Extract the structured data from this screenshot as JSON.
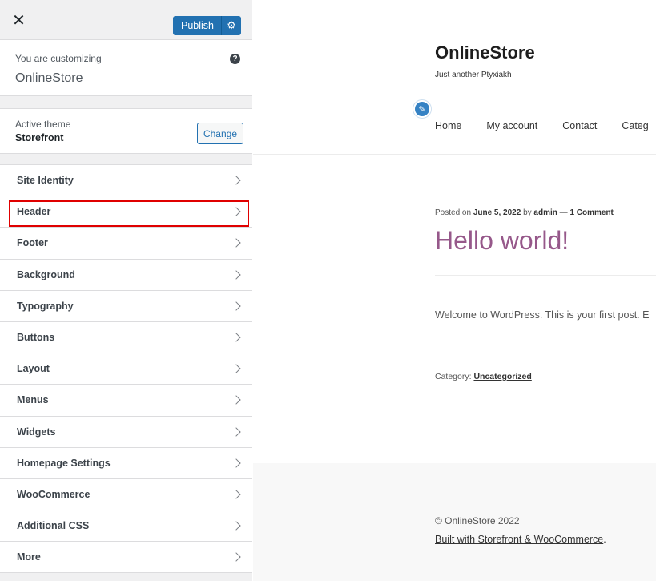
{
  "topbar": {
    "close_icon": "close-icon",
    "publish_label": "Publish",
    "settings_icon": "gear-icon"
  },
  "info": {
    "caption": "You are customizing",
    "site_name": "OnlineStore",
    "help_glyph": "?"
  },
  "theme": {
    "label": "Active theme",
    "name": "Storefront",
    "change_label": "Change"
  },
  "menu": [
    {
      "label": "Site Identity"
    },
    {
      "label": "Header",
      "highlighted": true
    },
    {
      "label": "Footer"
    },
    {
      "label": "Background"
    },
    {
      "label": "Typography"
    },
    {
      "label": "Buttons"
    },
    {
      "label": "Layout"
    },
    {
      "label": "Menus"
    },
    {
      "label": "Widgets"
    },
    {
      "label": "Homepage Settings"
    },
    {
      "label": "WooCommerce"
    },
    {
      "label": "Additional CSS"
    },
    {
      "label": "More"
    }
  ],
  "preview": {
    "site_title": "OnlineStore",
    "tagline": "Just another Ptyxiakh",
    "nav": [
      "Home",
      "My account",
      "Contact",
      "Categ"
    ],
    "post": {
      "posted_on": "Posted on ",
      "date": "June 5, 2022",
      "by": " by ",
      "author": "admin",
      "sep": " — ",
      "comments": "1 Comment",
      "title": "Hello world!",
      "body": "Welcome to WordPress. This is your first post. E",
      "category_label": "Category: ",
      "category": "Uncategorized"
    },
    "footer": {
      "copyright": "© OnlineStore 2022",
      "built_link": "Built with Storefront & WooCommerce",
      "built_suffix": "."
    }
  },
  "colors": {
    "accent": "#2271b1",
    "highlight_border": "#e00000",
    "post_title": "#96588a"
  }
}
